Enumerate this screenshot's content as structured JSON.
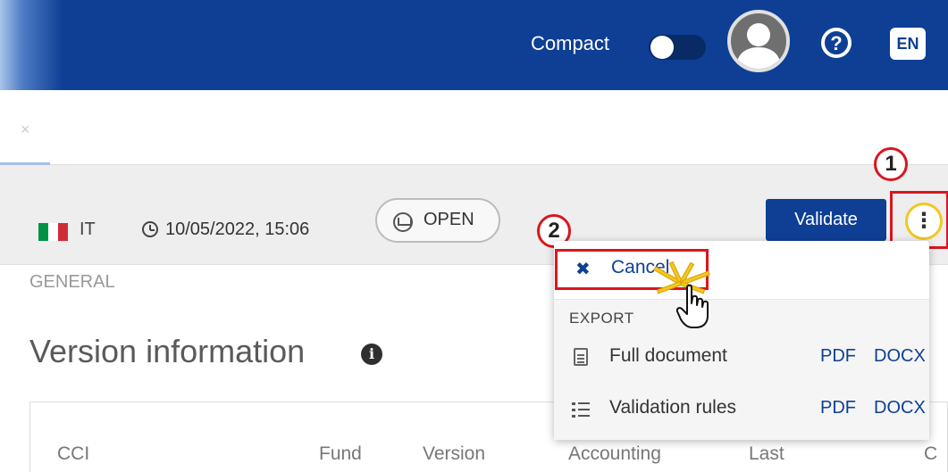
{
  "header": {
    "compact_label": "Compact",
    "compact_on": false,
    "help_icon": "question-circle-icon",
    "language": "EN",
    "colors": {
      "header_bg": "#0e3f95",
      "accent_red": "#d9161e",
      "highlight_yellow": "#f3c623"
    }
  },
  "tabs": {
    "close_glyph": "×"
  },
  "toolbar": {
    "country_code": "IT",
    "country_flag": "italy-flag-icon",
    "datetime": "10/05/2022, 15:06",
    "status": "OPEN",
    "validate_label": "Validate",
    "more_glyph": "⋮"
  },
  "callouts": {
    "first": "1",
    "second": "2"
  },
  "dropdown": {
    "cancel_label": "Cancel",
    "cancel_icon": "times-icon",
    "export_header": "EXPORT",
    "rows": [
      {
        "label": "Full document",
        "icon": "document-icon",
        "pdf": "PDF",
        "docx": "DOCX"
      },
      {
        "label": "Validation rules",
        "icon": "list-ordered-icon",
        "pdf": "PDF",
        "docx": "DOCX"
      }
    ]
  },
  "content": {
    "section_label": "GENERAL",
    "page_title": "Version information",
    "info_glyph": "i",
    "table_headers": [
      "CCI",
      "Fund",
      "Version",
      "Accounting",
      "Last",
      "C"
    ]
  }
}
